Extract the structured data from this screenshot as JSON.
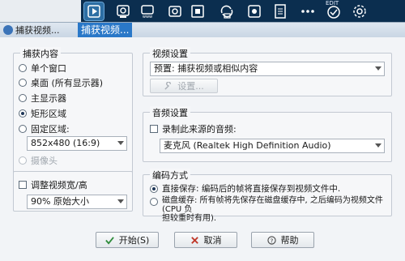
{
  "toolbar": {
    "edit_label": "EDIT",
    "icons": [
      "video-capture-icon",
      "webcam-capture-icon",
      "web-capture-icon",
      "image-capture-icon",
      "screenshot-icon",
      "convert-icon",
      "video-edit-icon",
      "document-icon",
      "more-icon",
      "edit-check-icon",
      "settings-icon"
    ]
  },
  "dialog": {
    "title": "捕获视频...",
    "title_highlight": "捕获视频..."
  },
  "capture_content": {
    "legend": "捕获内容",
    "options": [
      {
        "label": "单个窗口",
        "selected": false,
        "enabled": true
      },
      {
        "label": "桌面 (所有显示器)",
        "selected": false,
        "enabled": true
      },
      {
        "label": "主显示器",
        "selected": false,
        "enabled": true
      },
      {
        "label": "矩形区域",
        "selected": true,
        "enabled": true
      },
      {
        "label": "固定区域:",
        "selected": false,
        "enabled": true
      }
    ],
    "fixed_size_value": "852x480 (16:9)",
    "webcam_label": "摄像头"
  },
  "resize": {
    "checkbox_label": "调整视频宽/高",
    "scale_value": "90% 原始大小"
  },
  "video_settings": {
    "legend": "视频设置",
    "preset_value": "预置: 捕获视频或相似内容",
    "settings_button": "设置..."
  },
  "audio_settings": {
    "legend": "音频设置",
    "record_label": "录制此来源的音频:",
    "device_value": "麦克风 (Realtek High Definition Audio)"
  },
  "encoding": {
    "legend": "编码方式",
    "direct_label": "直接保存: 编码后的帧将直接保存到视频文件中.",
    "disk_label_line1": "磁盘缓存: 所有帧将先保存在磁盘缓存中, 之后编码为视频文件 (CPU 负",
    "disk_label_line2": "担较重时有用).",
    "direct_selected": true
  },
  "buttons": {
    "start": "开始(S)",
    "cancel": "取消",
    "help": "帮助"
  },
  "colors": {
    "toolbar_bg": "#0b2e4f",
    "title_highlight": "#2a78c8",
    "start_check": "#2e8b3a",
    "cancel_x": "#c0392b"
  }
}
